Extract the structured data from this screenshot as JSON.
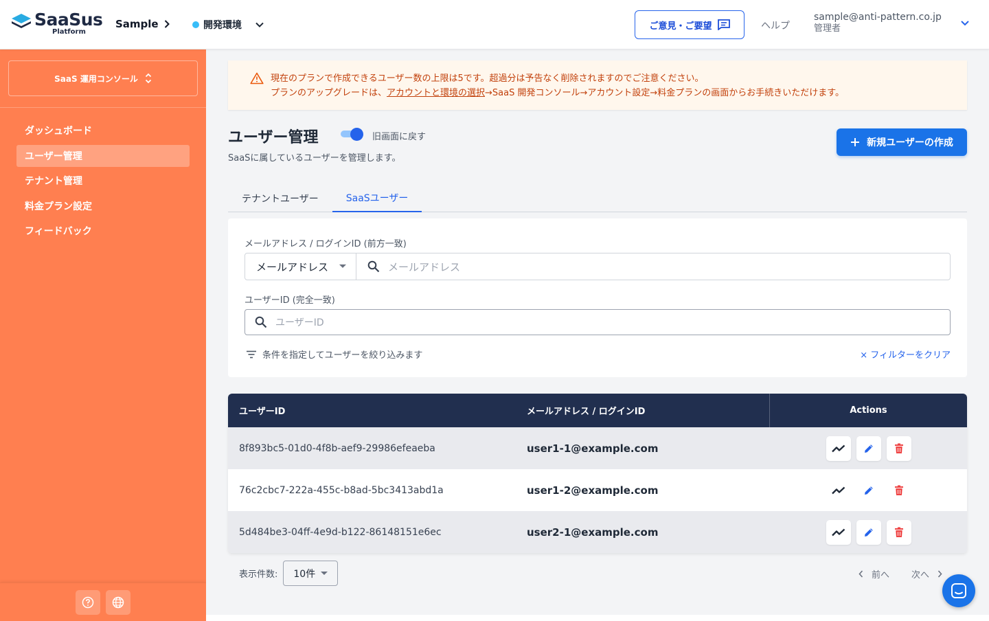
{
  "header": {
    "logo_name": "SaaSus",
    "logo_sub": "Platform",
    "app_name": "Sample",
    "env_name": "開発環境",
    "feedback_label": "ご意見・ご要望",
    "help_label": "ヘルプ",
    "user_email": "sample@anti-pattern.co.jp",
    "user_role": "管理者"
  },
  "sidebar": {
    "console_label": "SaaS 運用コンソール",
    "items": [
      {
        "label": "ダッシュボード",
        "active": false
      },
      {
        "label": "ユーザー管理",
        "active": true
      },
      {
        "label": "テナント管理",
        "active": false
      },
      {
        "label": "料金プラン設定",
        "active": false
      },
      {
        "label": "フィードバック",
        "active": false
      }
    ]
  },
  "notice": {
    "line1": "現在のプランで作成できるユーザー数の上限は5です。超過分は予告なく削除されますのでご注意ください。",
    "line2_prefix": "プランのアップグレードは、",
    "line2_link": "アカウントと環境の選択",
    "line2_suffix": "→SaaS 開発コンソール→アカウント設定→料金プランの画面からお手続きいただけます。"
  },
  "page": {
    "title": "ユーザー管理",
    "toggle_label": "旧画面に戻す",
    "toggle_on": true,
    "description": "SaaSに属しているユーザーを管理します。",
    "create_button": "新規ユーザーの作成"
  },
  "tabs": [
    {
      "label": "テナントユーザー",
      "active": false
    },
    {
      "label": "SaaSユーザー",
      "active": true
    }
  ],
  "filter": {
    "email_label": "メールアドレス / ログインID (前方一致)",
    "email_select_value": "メールアドレス",
    "email_placeholder": "メールアドレス",
    "userid_label": "ユーザーID (完全一致)",
    "userid_placeholder": "ユーザーID",
    "hint": "条件を指定してユーザーを絞り込みます",
    "clear_label": "× フィルターをクリア"
  },
  "table": {
    "columns": [
      "ユーザーID",
      "メールアドレス / ログインID",
      "Actions"
    ],
    "rows": [
      {
        "id": "8f893bc5-01d0-4f8b-aef9-29986efeaeba",
        "email": "user1-1@example.com"
      },
      {
        "id": "76c2cbc7-222a-455c-b8ad-5bc3413abd1a",
        "email": "user1-2@example.com"
      },
      {
        "id": "5d484be3-04ff-4e9d-b122-86148151e6ec",
        "email": "user2-1@example.com"
      }
    ]
  },
  "pagination": {
    "page_size_label": "表示件数:",
    "page_size_value": "10件",
    "prev_label": "前へ",
    "next_label": "次へ"
  },
  "colors": {
    "sidebar": "#ff7f50",
    "primary": "#1a73e8",
    "table_header": "#212f4f",
    "delete": "#ef4444"
  }
}
